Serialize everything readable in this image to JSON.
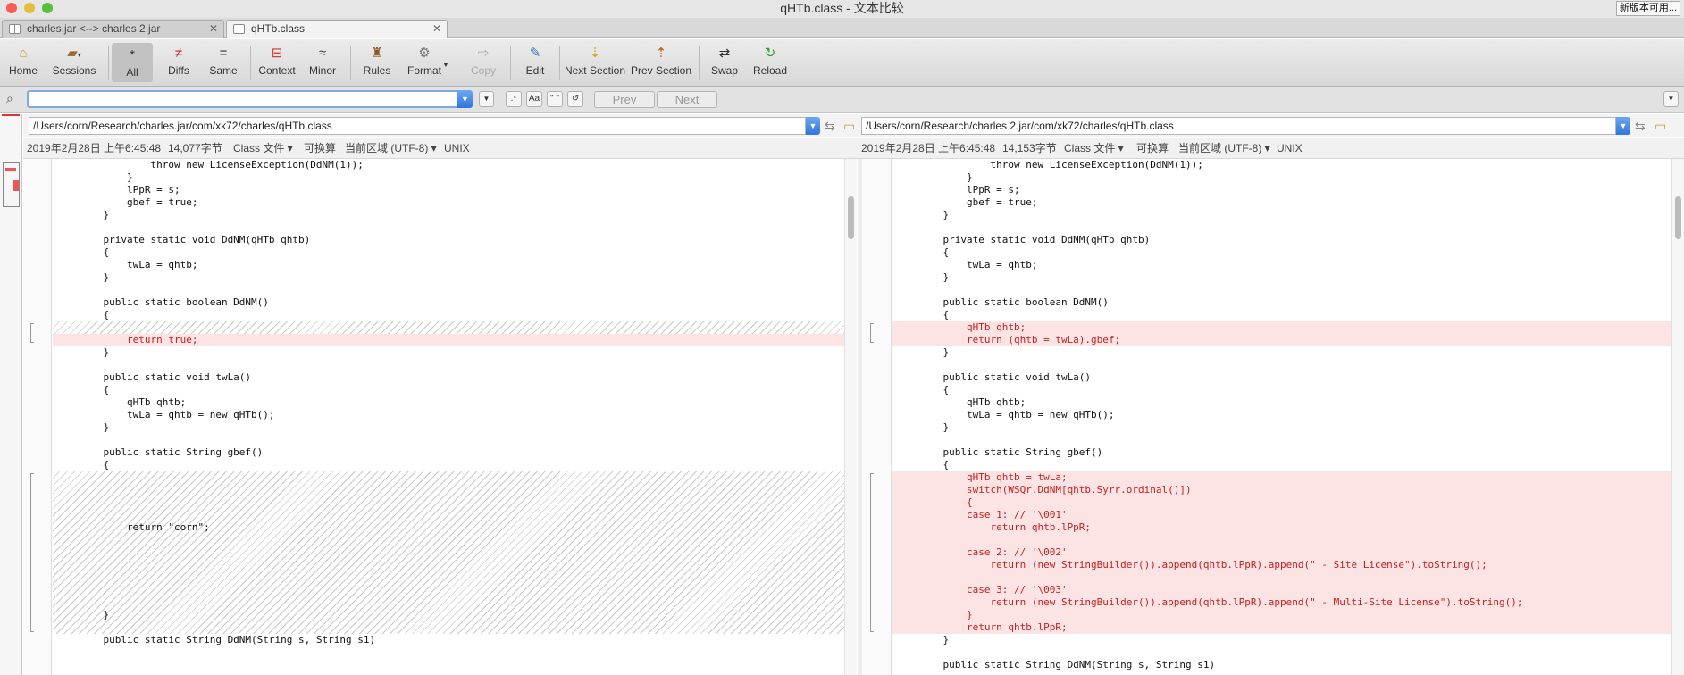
{
  "window": {
    "title": "qHTb.class - 文本比较",
    "update_badge": "新版本可用..."
  },
  "tabs": [
    {
      "label": "charles.jar <--> charles 2.jar"
    },
    {
      "label": "qHTb.class"
    }
  ],
  "toolbar": [
    {
      "label": "Home",
      "icon": "home-icon"
    },
    {
      "label": "Sessions",
      "icon": "briefcase-icon"
    },
    {
      "label": "All",
      "icon": "asterisk-icon",
      "glyph": "*"
    },
    {
      "label": "Diffs",
      "icon": "not-equal-icon",
      "glyph": "≠"
    },
    {
      "label": "Same",
      "icon": "equal-icon",
      "glyph": "="
    },
    {
      "label": "Context",
      "icon": "context-icon",
      "glyph": "⊟"
    },
    {
      "label": "Minor",
      "icon": "approx-icon",
      "glyph": "≈"
    },
    {
      "label": "Rules",
      "icon": "rules-icon",
      "glyph": "♜"
    },
    {
      "label": "Format",
      "icon": "format-icon",
      "glyph": "⚙"
    },
    {
      "label": "Copy",
      "icon": "copy-icon",
      "glyph": "⇨"
    },
    {
      "label": "Edit",
      "icon": "edit-icon",
      "glyph": "✎"
    },
    {
      "label": "Next Section",
      "icon": "next-section-icon",
      "glyph": "⇣"
    },
    {
      "label": "Prev Section",
      "icon": "prev-section-icon",
      "glyph": "⇡"
    },
    {
      "label": "Swap",
      "icon": "swap-icon",
      "glyph": "⇄"
    },
    {
      "label": "Reload",
      "icon": "reload-icon",
      "glyph": "↻"
    }
  ],
  "filter": {
    "search_value": "",
    "regex_label": ".*",
    "case_label": "Aa",
    "quote_label": "\" \"",
    "reset_label": "↺",
    "prev_label": "Prev",
    "next_label": "Next"
  },
  "left": {
    "path": "/Users/corn/Research/charles.jar/com/xk72/charles/qHTb.class",
    "timestamp": "2019年2月28日 上午6:45:48",
    "size": "14,077字节",
    "filetype": "Class 文件",
    "convertible": "可换算",
    "encoding": "当前区域 (UTF-8)",
    "lineend": "UNIX"
  },
  "right": {
    "path": "/Users/corn/Research/charles 2.jar/com/xk72/charles/qHTb.class",
    "timestamp": "2019年2月28日 上午6:45:48",
    "size": "14,153字节",
    "filetype": "Class 文件",
    "convertible": "可换算",
    "encoding": "当前区域 (UTF-8)",
    "lineend": "UNIX"
  },
  "left_code": [
    "            throw new LicenseException(DdNM(1));",
    "        }",
    "        lPpR = s;",
    "        gbef = true;",
    "    }",
    "",
    "    private static void DdNM(qHTb qhtb)",
    "    {",
    "        twLa = qhtb;",
    "    }",
    "",
    "    public static boolean DdNM()",
    "    {",
    "        return true;",
    "    }",
    "",
    "    public static void twLa()",
    "    {",
    "        qHTb qhtb;",
    "        twLa = qhtb = new qHTb();",
    "    }",
    "",
    "    public static String gbef()",
    "    {",
    "        return \"corn\";",
    "    }",
    "",
    "    public static String DdNM(String s, String s1)"
  ],
  "right_code": [
    "            throw new LicenseException(DdNM(1));",
    "        }",
    "        lPpR = s;",
    "        gbef = true;",
    "    }",
    "",
    "    private static void DdNM(qHTb qhtb)",
    "    {",
    "        twLa = qhtb;",
    "    }",
    "",
    "    public static boolean DdNM()",
    "    {",
    "        qHTb qhtb;",
    "        return (qhtb = twLa).gbef;",
    "    }",
    "",
    "    public static void twLa()",
    "    {",
    "        qHTb qhtb;",
    "        twLa = qhtb = new qHTb();",
    "    }",
    "",
    "    public static String gbef()",
    "    {",
    "        qHTb qhtb = twLa;",
    "        switch(WSQr.DdNM[qhtb.Syrr.ordinal()])",
    "        {",
    "        case 1: // '\\001'",
    "            return qhtb.lPpR;",
    "",
    "        case 2: // '\\002'",
    "            return (new StringBuilder()).append(qhtb.lPpR).append(\" - Site License\").toString();",
    "",
    "        case 3: // '\\003'",
    "            return (new StringBuilder()).append(qhtb.lPpR).append(\" - Multi-Site License\").toString();",
    "        }",
    "        return qhtb.lPpR;",
    "    }",
    "",
    "    public static String DdNM(String s, String s1)"
  ],
  "colors": {
    "diff_bg": "#fde4e4",
    "diff_text": "#c42020",
    "accent": "#2f76dc"
  }
}
